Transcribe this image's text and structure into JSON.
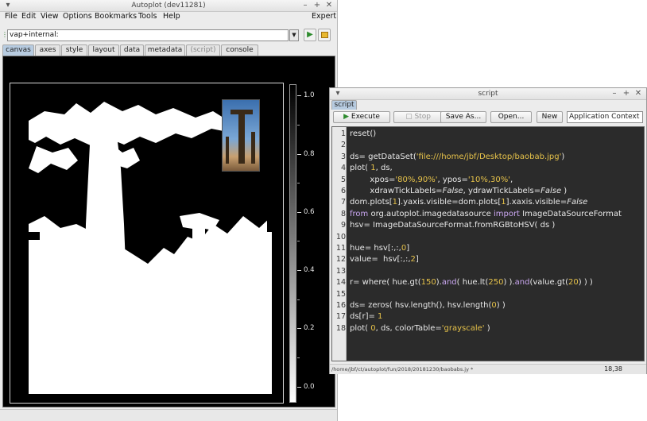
{
  "main_window": {
    "title": "Autoplot (dev11281)",
    "controls": {
      "collapse": "▾",
      "minimize": "–",
      "maximize": "+",
      "close": "✕"
    },
    "menu": [
      "File",
      "Edit",
      "View",
      "Options",
      "Bookmarks",
      "Tools",
      "Help"
    ],
    "expert_label": "Expert",
    "url_value": "vap+internal:",
    "tabs": [
      "canvas",
      "axes",
      "style",
      "layout",
      "data",
      "metadata",
      "(script)",
      "console"
    ],
    "active_tab": "canvas",
    "colorbar": {
      "colors": [
        "#000000",
        "#ffffff"
      ],
      "ticks": [
        "1.0",
        "0.8",
        "0.6",
        "0.4",
        "0.2",
        "0.0"
      ]
    }
  },
  "script_window": {
    "title": "script",
    "controls": {
      "collapse": "▾",
      "minimize": "–",
      "maximize": "+",
      "close": "✕"
    },
    "tab_label": "script",
    "toolbar": {
      "execute": "Execute",
      "stop": "Stop",
      "save_as": "Save As...",
      "open": "Open...",
      "new": "New",
      "context": "Application Context"
    },
    "code_lines": [
      [
        {
          "t": "reset()"
        }
      ],
      [],
      [
        {
          "t": "ds= getDataSet("
        },
        {
          "t": "'file:///home/jbf/Desktop/baobab.jpg'",
          "c": "str"
        },
        {
          "t": ")"
        }
      ],
      [
        {
          "t": "plot( "
        },
        {
          "t": "1",
          "c": "num"
        },
        {
          "t": ", ds,"
        }
      ],
      [
        {
          "t": "        xpos="
        },
        {
          "t": "'80%,90%'",
          "c": "str"
        },
        {
          "t": ", ypos="
        },
        {
          "t": "'10%,30%'",
          "c": "str"
        },
        {
          "t": ","
        }
      ],
      [
        {
          "t": "        xdrawTickLabels="
        },
        {
          "t": "False",
          "c": "it"
        },
        {
          "t": ", ydrawTickLabels="
        },
        {
          "t": "False",
          "c": "it"
        },
        {
          "t": " )"
        }
      ],
      [
        {
          "t": "dom.plots["
        },
        {
          "t": "1",
          "c": "num"
        },
        {
          "t": "].yaxis.visible=dom.plots["
        },
        {
          "t": "1",
          "c": "num"
        },
        {
          "t": "].xaxis.visible="
        },
        {
          "t": "False",
          "c": "it"
        }
      ],
      [
        {
          "t": "from",
          "c": "kw"
        },
        {
          "t": " org.autoplot.imagedatasource "
        },
        {
          "t": "import",
          "c": "kw"
        },
        {
          "t": " ImageDataSourceFormat"
        }
      ],
      [
        {
          "t": "hsv= ImageDataSourceFormat.fromRGBtoHSV( ds )"
        }
      ],
      [],
      [
        {
          "t": "hue= hsv[:,:,"
        },
        {
          "t": "0",
          "c": "num"
        },
        {
          "t": "]"
        }
      ],
      [
        {
          "t": "value=  hsv[:,:,"
        },
        {
          "t": "2",
          "c": "num"
        },
        {
          "t": "]"
        }
      ],
      [],
      [
        {
          "t": "r= where( hue.gt("
        },
        {
          "t": "150",
          "c": "num"
        },
        {
          "t": ")."
        },
        {
          "t": "and",
          "c": "kw"
        },
        {
          "t": "( hue.lt("
        },
        {
          "t": "250",
          "c": "num"
        },
        {
          "t": ") )."
        },
        {
          "t": "and",
          "c": "kw"
        },
        {
          "t": "(value.gt("
        },
        {
          "t": "20",
          "c": "num"
        },
        {
          "t": ") ) )"
        }
      ],
      [],
      [
        {
          "t": "ds= zeros( hsv.length(), hsv.length("
        },
        {
          "t": "0",
          "c": "num"
        },
        {
          "t": ") )"
        }
      ],
      [
        {
          "t": "ds[r]= "
        },
        {
          "t": "1",
          "c": "num"
        }
      ],
      [
        {
          "t": "plot( "
        },
        {
          "t": "0",
          "c": "num"
        },
        {
          "t": ", ds, colorTable="
        },
        {
          "t": "'grayscale'",
          "c": "str"
        },
        {
          "t": " )"
        }
      ]
    ],
    "status_path": "/home/jbf/ct/autoplot/fun/2018/20181230/baobabs.jy *",
    "cursor_pos": "18,38"
  }
}
